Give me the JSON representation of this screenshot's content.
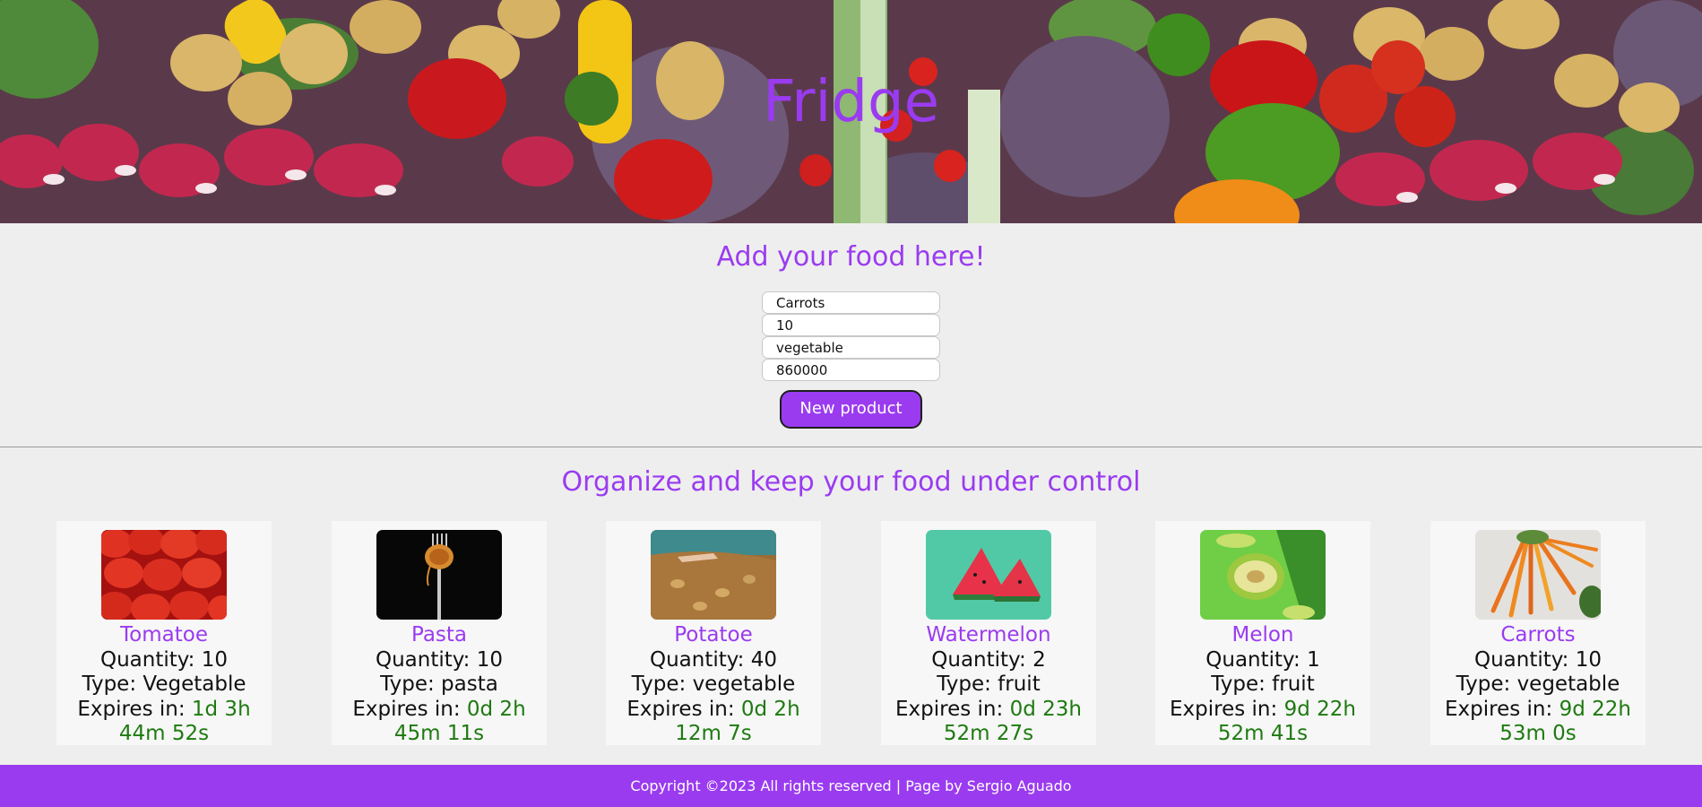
{
  "header": {
    "title": "Fridge"
  },
  "form": {
    "heading": "Add your food here!",
    "name_value": "Carrots",
    "quantity_value": "10",
    "type_value": "vegetable",
    "expiry_value": "860000",
    "submit_label": "New product"
  },
  "list": {
    "heading": "Organize and keep your food under control",
    "quantity_prefix": "Quantity: ",
    "type_prefix": "Type: ",
    "expires_prefix": "Expires in: ",
    "items": [
      {
        "name": "Tomatoe",
        "quantity": "10",
        "type": "Vegetable",
        "expires_line1": "1d 3h",
        "expires_line2": "44m 52s",
        "image": "tomatoes-photo"
      },
      {
        "name": "Pasta",
        "quantity": "10",
        "type": "pasta",
        "expires_line1": "0d 2h",
        "expires_line2": "45m 11s",
        "image": "pasta-fork-photo"
      },
      {
        "name": "Potatoe",
        "quantity": "40",
        "type": "vegetable",
        "expires_line1": "0d 2h",
        "expires_line2": "12m 7s",
        "image": "potato-field-photo"
      },
      {
        "name": "Watermelon",
        "quantity": "2",
        "type": "fruit",
        "expires_line1": "0d 23h",
        "expires_line2": "52m 27s",
        "image": "watermelon-photo"
      },
      {
        "name": "Melon",
        "quantity": "1",
        "type": "fruit",
        "expires_line1": "9d 22h",
        "expires_line2": "52m 41s",
        "image": "melon-photo"
      },
      {
        "name": "Carrots",
        "quantity": "10",
        "type": "vegetable",
        "expires_line1": "9d 22h",
        "expires_line2": "53m 0s",
        "image": "carrots-photo"
      }
    ]
  },
  "footer": {
    "text": "Copyright ©2023 All rights reserved | Page by Sergio Aguado"
  },
  "colors": {
    "accent": "#9a3bf0",
    "expiry": "#1e7a10",
    "background": "#eeeeee",
    "card": "#f7f7f7"
  }
}
